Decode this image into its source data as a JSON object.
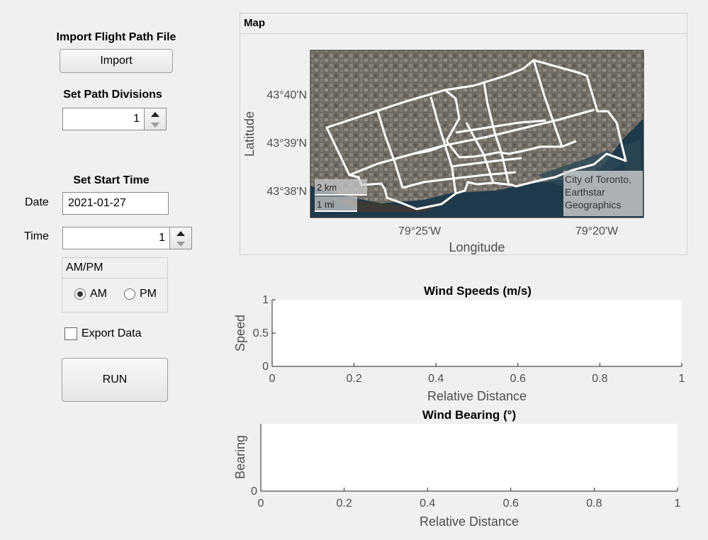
{
  "left_panel": {
    "import_heading": "Import Flight Path File",
    "import_button": "Import",
    "divisions_heading": "Set Path Divisions",
    "divisions_value": "1",
    "start_time_heading": "Set Start Time",
    "date_label": "Date",
    "date_value": "2021-01-27",
    "time_label": "Time",
    "time_value": "1",
    "ampm": {
      "title": "AM/PM",
      "options": [
        "AM",
        "PM"
      ],
      "selected": "AM"
    },
    "export_label": "Export Data",
    "export_checked": false,
    "run_button": "RUN"
  },
  "map_panel": {
    "title": "Map",
    "ylabel": "Latitude",
    "xlabel": "Longitude",
    "lat_ticks": [
      "43°40'N",
      "43°39'N",
      "43°38'N"
    ],
    "lon_ticks": [
      "79°25'W",
      "79°20'W"
    ],
    "scale_km": "2 km",
    "scale_mi": "1 mi",
    "attribution_lines": [
      "City of Toronto,",
      "Earthstar",
      "Geographics"
    ]
  },
  "chart_data": [
    {
      "type": "line",
      "title": "Wind Speeds (m/s)",
      "xlabel": "Relative Distance",
      "ylabel": "Speed",
      "xlim": [
        0,
        1
      ],
      "ylim": [
        0,
        1
      ],
      "x_ticks": [
        "0",
        "0.2",
        "0.4",
        "0.6",
        "0.8",
        "1"
      ],
      "y_ticks": [
        "0",
        "0.5",
        "1"
      ],
      "series": []
    },
    {
      "type": "line",
      "title": "Wind Bearing (°)",
      "xlabel": "Relative Distance",
      "ylabel": "Bearing",
      "xlim": [
        0,
        1
      ],
      "x_ticks": [
        "0",
        "0.2",
        "0.4",
        "0.6",
        "0.8",
        "1"
      ],
      "y_ticks": [
        "0"
      ],
      "series": []
    }
  ]
}
